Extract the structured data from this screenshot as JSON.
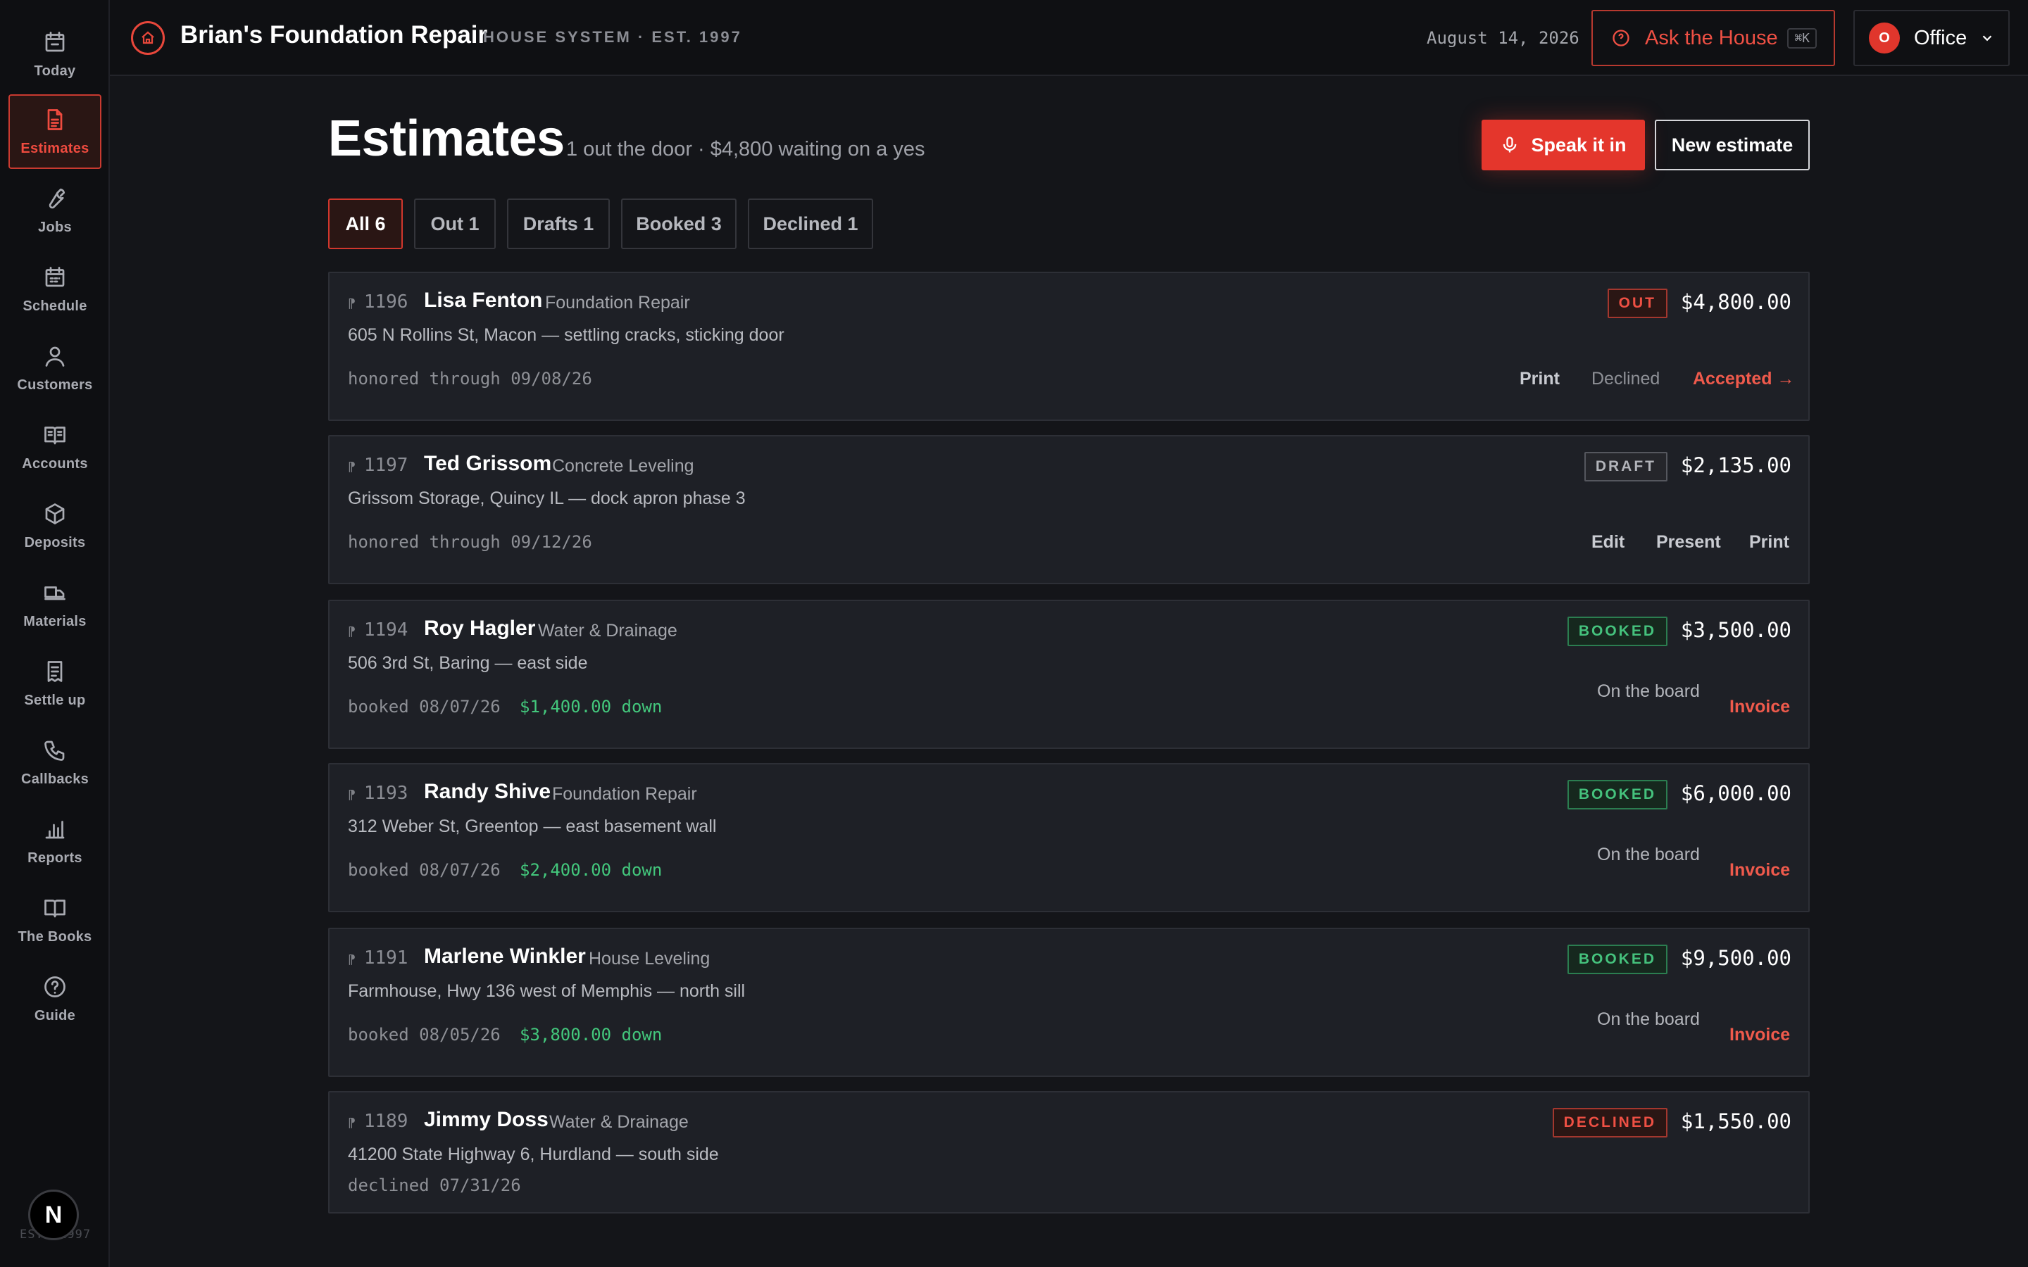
{
  "sidebar": {
    "items": [
      {
        "label": "Today",
        "icon": "calendar-icon"
      },
      {
        "label": "Estimates",
        "icon": "document-icon"
      },
      {
        "label": "Jobs",
        "icon": "wrench-icon"
      },
      {
        "label": "Schedule",
        "icon": "calendar-grid-icon"
      },
      {
        "label": "Customers",
        "icon": "person-icon"
      },
      {
        "label": "Accounts",
        "icon": "book-open-icon"
      },
      {
        "label": "Deposits",
        "icon": "box-icon"
      },
      {
        "label": "Materials",
        "icon": "truck-icon"
      },
      {
        "label": "Settle up",
        "icon": "receipt-icon"
      },
      {
        "label": "Callbacks",
        "icon": "phone-icon"
      },
      {
        "label": "Reports",
        "icon": "bar-chart-icon"
      },
      {
        "label": "The Books",
        "icon": "book-icon"
      },
      {
        "label": "Guide",
        "icon": "help-circle-icon"
      }
    ],
    "active_index": 1,
    "avatar_letter": "N",
    "footer": "EST. 1997"
  },
  "header": {
    "brand": "Brian's Foundation Repair",
    "tagline": "HOUSE SYSTEM · EST. 1997",
    "date": "August 14, 2026",
    "ask_label": "Ask the House",
    "ask_shortcut": "⌘K",
    "office_initial": "O",
    "office_label": "Office"
  },
  "page": {
    "title": "Estimates",
    "subtitle": "1 out the door · $4,800 waiting on a yes",
    "speak_label": "Speak it in",
    "new_label": "New estimate"
  },
  "tabs": [
    {
      "label": "All 6",
      "active": true
    },
    {
      "label": "Out 1"
    },
    {
      "label": "Drafts 1"
    },
    {
      "label": "Booked 3"
    },
    {
      "label": "Declined 1"
    }
  ],
  "estimates": [
    {
      "num": "1196",
      "name": "Lisa Fenton",
      "type": "Foundation Repair",
      "address": "605 N Rollins St, Macon — settling cracks, sticking door",
      "meta": "honored through 09/08/26",
      "status": "OUT",
      "amount": "$4,800.00",
      "actions": [
        "Print",
        "Declined",
        "Accepted →"
      ]
    },
    {
      "num": "1197",
      "name": "Ted Grissom",
      "type": "Concrete Leveling",
      "address": "Grissom Storage, Quincy IL — dock apron phase 3",
      "meta": "honored through 09/12/26",
      "status": "DRAFT",
      "amount": "$2,135.00",
      "actions": [
        "Edit",
        "Present",
        "Print"
      ]
    },
    {
      "num": "1194",
      "name": "Roy Hagler",
      "type": "Water & Drainage",
      "address": "506 3rd St, Baring — east side",
      "meta": "booked 08/07/26",
      "down": "$1,400.00 down",
      "status": "BOOKED",
      "amount": "$3,500.00",
      "board": "On the board",
      "actions": [
        "Invoice"
      ]
    },
    {
      "num": "1193",
      "name": "Randy Shive",
      "type": "Foundation Repair",
      "address": "312 Weber St, Greentop — east basement wall",
      "meta": "booked 08/07/26",
      "down": "$2,400.00 down",
      "status": "BOOKED",
      "amount": "$6,000.00",
      "board": "On the board",
      "actions": [
        "Invoice"
      ]
    },
    {
      "num": "1191",
      "name": "Marlene Winkler",
      "type": "House Leveling",
      "address": "Farmhouse, Hwy 136 west of Memphis — north sill",
      "meta": "booked 08/05/26",
      "down": "$3,800.00 down",
      "status": "BOOKED",
      "amount": "$9,500.00",
      "board": "On the board",
      "actions": [
        "Invoice"
      ]
    },
    {
      "num": "1189",
      "name": "Jimmy Doss",
      "type": "Water & Drainage",
      "address": "41200 State Highway 6, Hurdland — south side",
      "meta": "declined 07/31/26",
      "status": "DECLINED",
      "amount": "$1,550.00",
      "actions": []
    }
  ]
}
